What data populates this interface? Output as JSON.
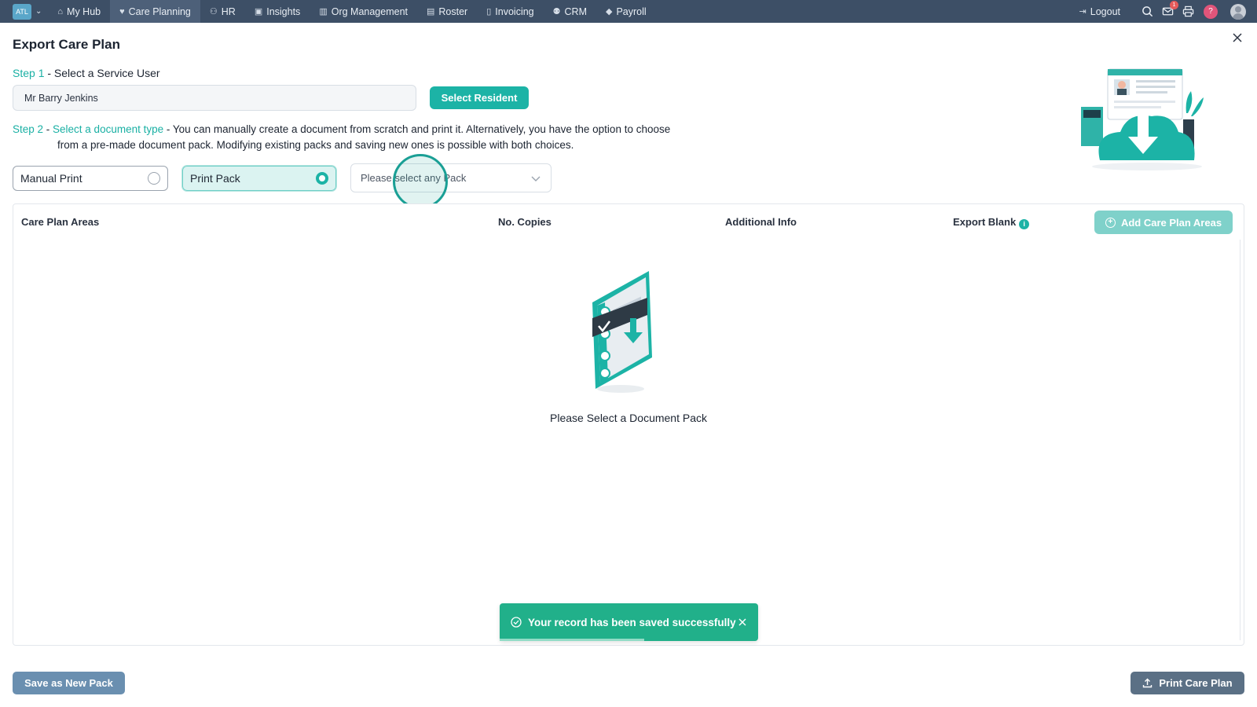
{
  "nav": {
    "brand": "ATL",
    "items": [
      {
        "label": "My Hub",
        "icon": "home-icon"
      },
      {
        "label": "Care Planning",
        "icon": "heart-icon"
      },
      {
        "label": "HR",
        "icon": "people-icon"
      },
      {
        "label": "Insights",
        "icon": "chart-icon"
      },
      {
        "label": "Org Management",
        "icon": "building-icon"
      },
      {
        "label": "Roster",
        "icon": "calendar-icon"
      },
      {
        "label": "Invoicing",
        "icon": "document-icon"
      },
      {
        "label": "CRM",
        "icon": "contacts-icon"
      },
      {
        "label": "Payroll",
        "icon": "tag-icon"
      }
    ],
    "active": "Care Planning",
    "logout": "Logout",
    "mail_count": "1",
    "help": "?"
  },
  "page": {
    "title": "Export Care Plan",
    "step1_key": "Step 1",
    "step1_text": " - Select a Service User",
    "resident_value": "Mr Barry Jenkins",
    "select_resident": "Select Resident",
    "step2_key": "Step 2",
    "step2_dash": " - ",
    "step2_label": "Select a document type",
    "step2_text_a": " - You can manually create a document from scratch and print it. Alternatively, you have the option to choose",
    "step2_text_b": "from a pre-made document pack. Modifying existing packs and saving new ones is possible with both choices.",
    "option_manual": "Manual Print",
    "option_pack": "Print Pack",
    "selected_option": "Print Pack",
    "pack_placeholder": "Please select any Pack"
  },
  "table": {
    "headers": [
      "Care Plan Areas",
      "No. Copies",
      "Additional Info",
      "Export Blank"
    ],
    "export_blank_info": "i",
    "add_button": "Add Care Plan Areas",
    "empty_message": "Please Select a Document Pack"
  },
  "toast": {
    "message": "Your record has been saved successfully",
    "progress": 0.56
  },
  "footer": {
    "save_pack": "Save as New Pack",
    "print_plan": "Print Care Plan"
  },
  "colors": {
    "nav_bg": "#3d4f66",
    "accent": "#1cb3a6",
    "toast_bg": "#21b08a",
    "save_btn": "#6a8fb0",
    "print_btn": "#5b7085"
  }
}
